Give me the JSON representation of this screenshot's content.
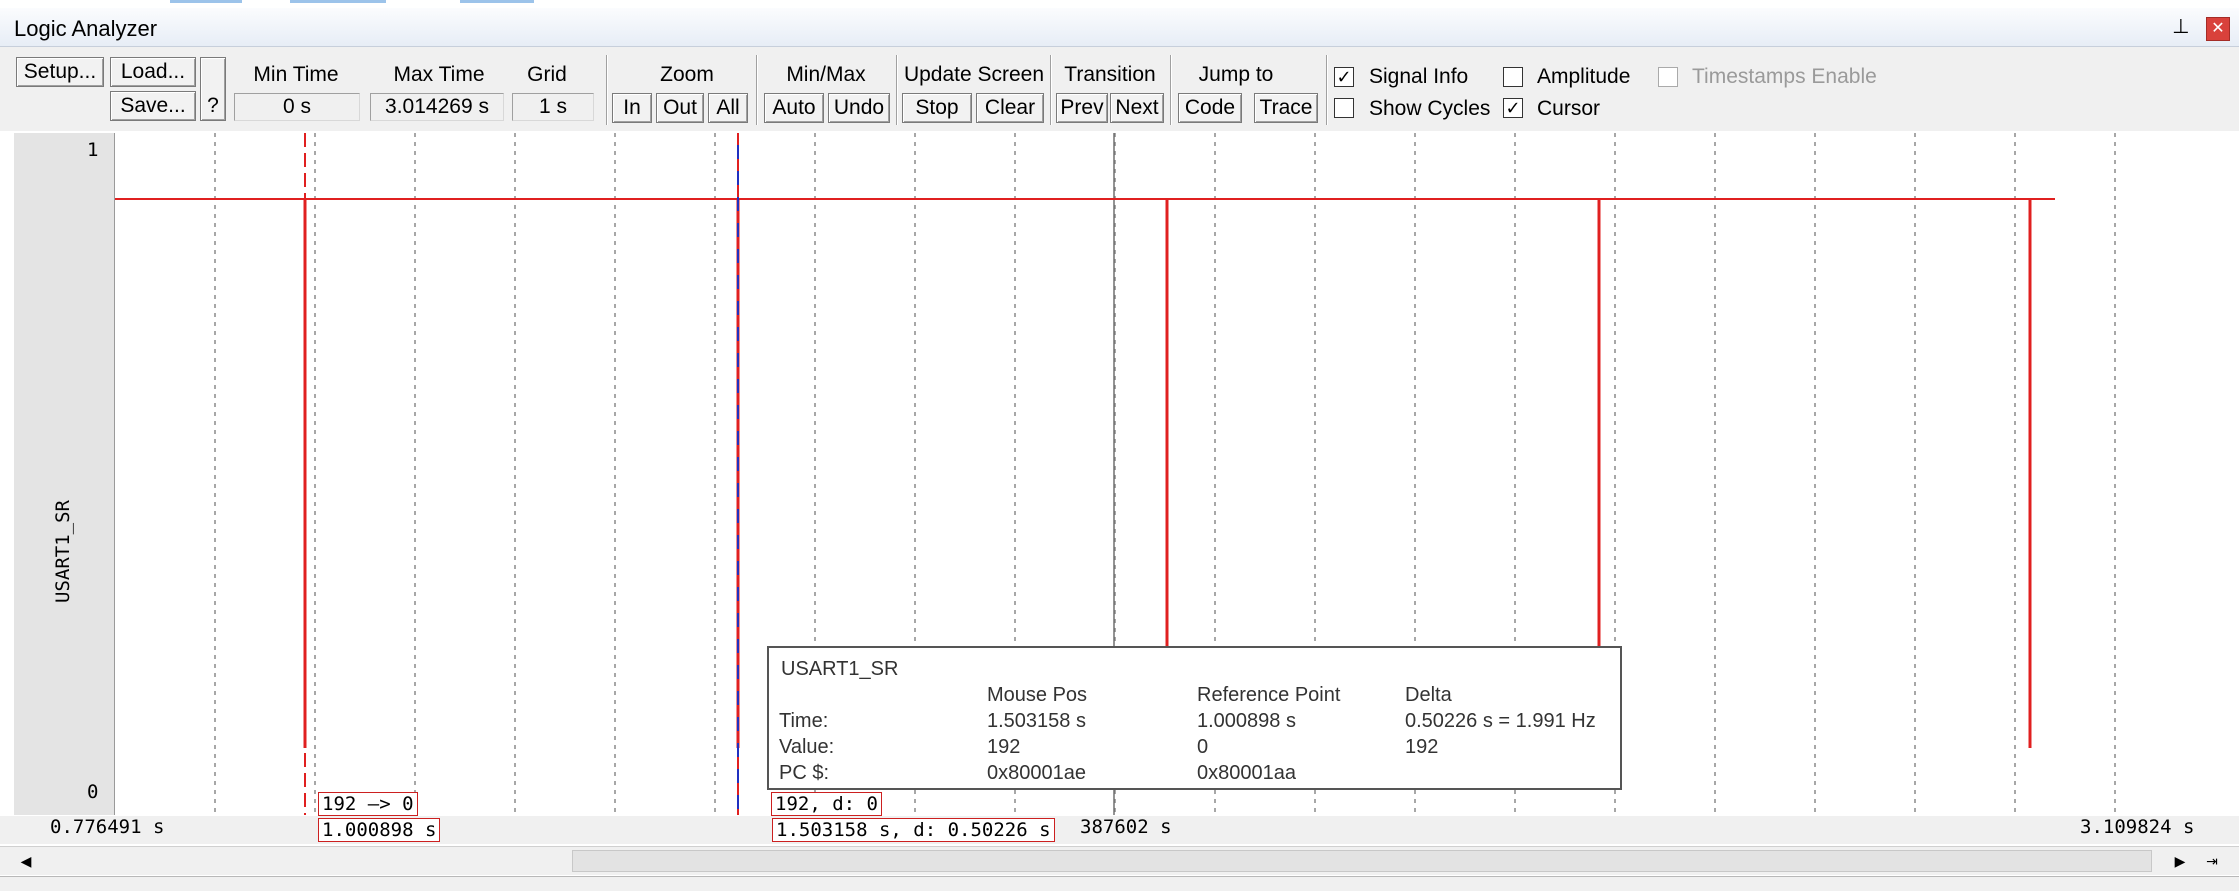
{
  "window": {
    "title": "Logic Analyzer"
  },
  "toolbar": {
    "setup_label": "Setup...",
    "load_label": "Load...",
    "save_label": "Save...",
    "help_label": "?",
    "min_time": {
      "label": "Min Time",
      "value": "0 s"
    },
    "max_time": {
      "label": "Max Time",
      "value": "3.014269 s"
    },
    "grid": {
      "label": "Grid",
      "value": "1 s"
    },
    "zoom": {
      "label": "Zoom",
      "in": "In",
      "out": "Out",
      "all": "All"
    },
    "minmax": {
      "label": "Min/Max",
      "auto": "Auto",
      "undo": "Undo"
    },
    "update_screen": {
      "label": "Update Screen",
      "stop": "Stop",
      "clear": "Clear"
    },
    "transition": {
      "label": "Transition",
      "prev": "Prev",
      "next": "Next"
    },
    "jump_to": {
      "label": "Jump to",
      "code": "Code",
      "trace": "Trace"
    },
    "options": {
      "signal_info": {
        "label": "Signal Info",
        "checked": true
      },
      "show_cycles": {
        "label": "Show Cycles",
        "checked": false
      },
      "amplitude": {
        "label": "Amplitude",
        "checked": false
      },
      "cursor": {
        "label": "Cursor",
        "checked": true
      },
      "timestamps_enable": {
        "label": "Timestamps Enable",
        "checked": false,
        "enabled": false
      }
    }
  },
  "signal": {
    "name": "USART1_SR",
    "y_max_label": "1",
    "y_min_label": "0"
  },
  "waveform": {
    "color": "#e02020",
    "transition_label": "192 —> 0",
    "reference_time_label": "1.000898 s",
    "cursor_label": "192,  d: 0",
    "cursor_time_label": "1.503158 s,  d: 0.50226 s",
    "axis_start": "0.776491 s",
    "axis_mid_partial": "387602 s",
    "axis_end": "3.109824 s",
    "pulse_times_s": [
      1.000898,
      1.503158,
      2.0,
      2.5,
      3.0
    ]
  },
  "tooltip": {
    "title": "USART1_SR",
    "headers": {
      "mouse_pos": "Mouse Pos",
      "reference_point": "Reference Point",
      "delta": "Delta"
    },
    "rows": [
      {
        "label": "Time:",
        "mouse": "1.503158 s",
        "ref": "1.000898 s",
        "delta": "0.50226 s = 1.991 Hz"
      },
      {
        "label": "Value:",
        "mouse": "192",
        "ref": "0",
        "delta": "192"
      },
      {
        "label": "PC $:",
        "mouse": "0x80001ae",
        "ref": "0x80001aa",
        "delta": ""
      }
    ]
  }
}
